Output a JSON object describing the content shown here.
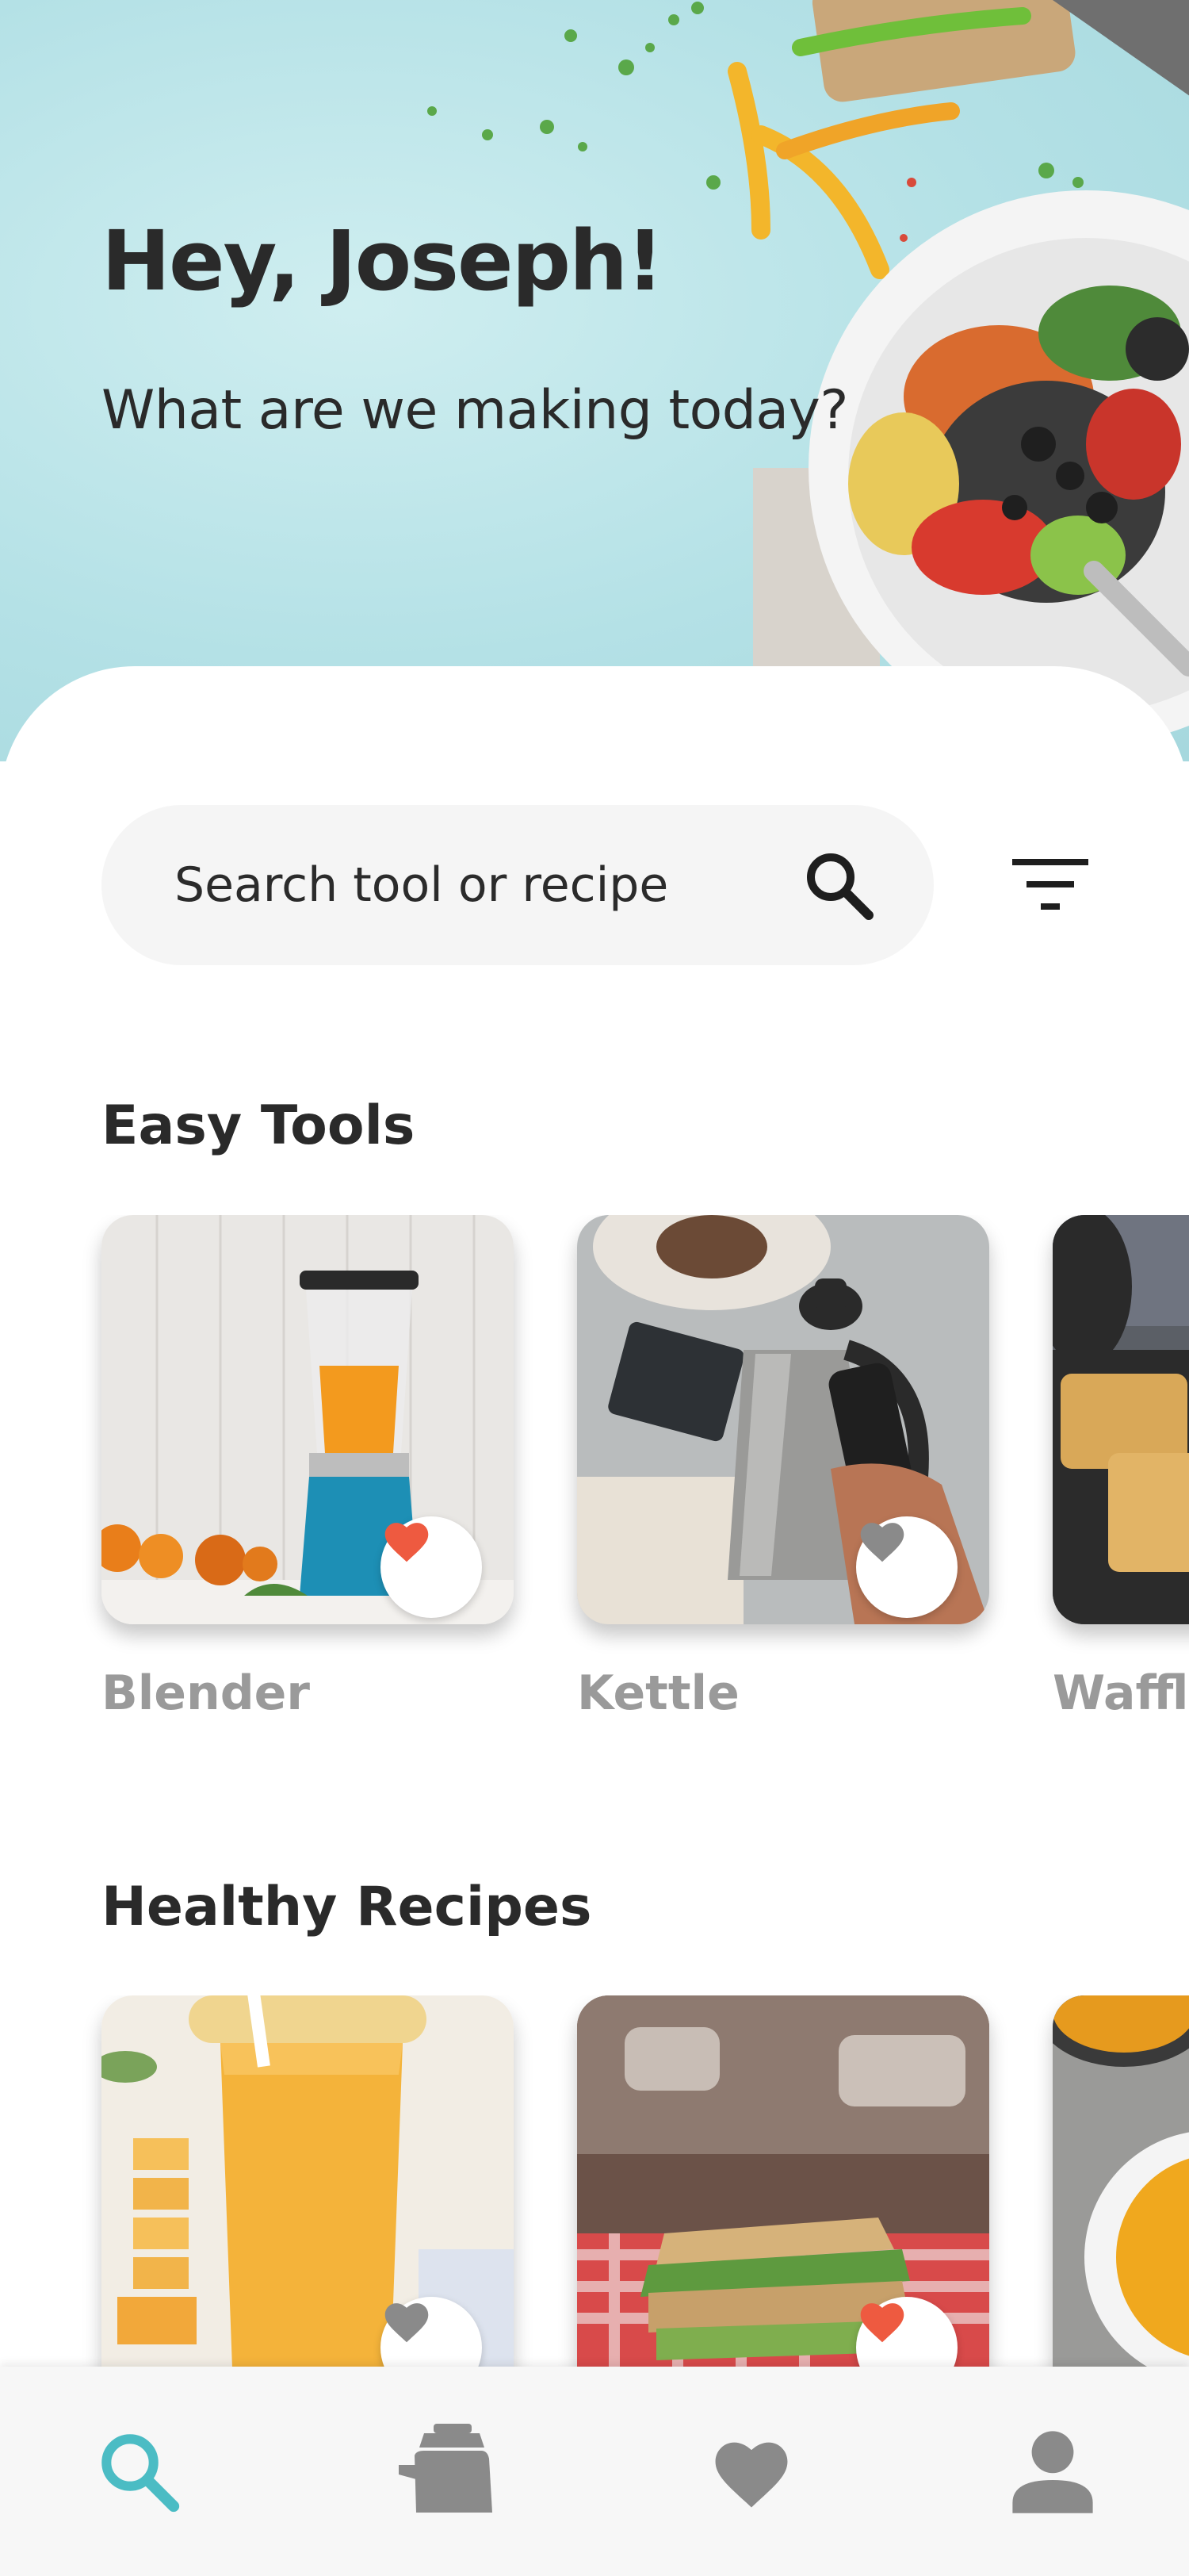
{
  "hero": {
    "greeting": "Hey, Joseph!",
    "subtitle": "What are we making today?"
  },
  "search": {
    "placeholder": "Search tool or recipe",
    "icon": "search-icon",
    "filter_icon": "filter-icon"
  },
  "easy_tools": {
    "title": "Easy Tools",
    "items": [
      {
        "label": "Blender",
        "favorited": true
      },
      {
        "label": "Kettle",
        "favorited": false
      },
      {
        "label": "Waffle",
        "favorited": false
      }
    ]
  },
  "healthy_recipes": {
    "title": "Healthy Recipes",
    "items": [
      {
        "favorited": false
      },
      {
        "favorited": true
      },
      {
        "favorited": false
      }
    ]
  },
  "nav": {
    "items": [
      {
        "icon": "search-icon",
        "active": true
      },
      {
        "icon": "kettle-icon",
        "active": false
      },
      {
        "icon": "heart-icon",
        "active": false
      },
      {
        "icon": "person-icon",
        "active": false
      }
    ]
  },
  "colors": {
    "accent": "#4bbcc4",
    "favorite": "#ee5a40",
    "inactive_icon": "#8a8a8a",
    "label_gray": "#9a9a9a"
  }
}
